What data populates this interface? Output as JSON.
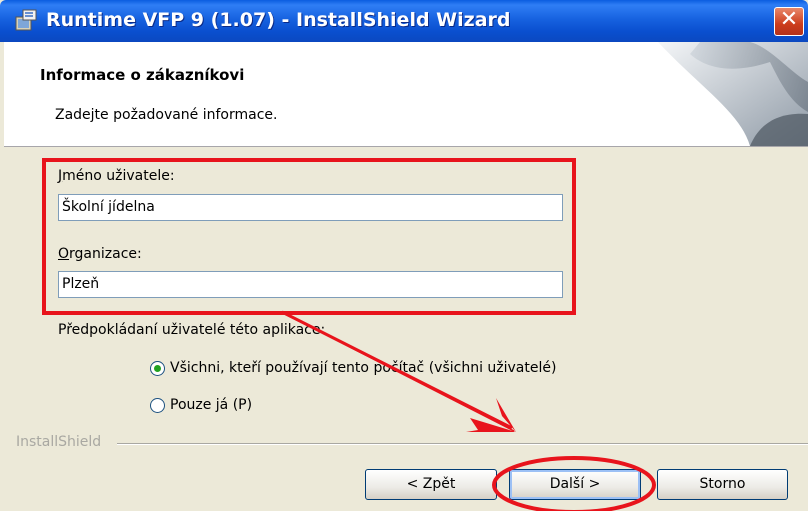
{
  "window": {
    "title": "Runtime VFP 9 (1.07) - InstallShield Wizard",
    "close_glyph": "✕"
  },
  "header": {
    "title": "Informace o zákazníkovi",
    "subtitle": "Zadejte požadované informace."
  },
  "form": {
    "username_label_accel": "J",
    "username_label_rest": "méno uživatele:",
    "username_value": "Školní jídelna",
    "org_label_accel": "O",
    "org_label_rest": "rganizace:",
    "org_value": "Plzeň",
    "users_question": "Předpokládaní uživatelé této aplikace:",
    "option_all": "Všichni, kteří používají tento počítač (všichni uživatelé)",
    "option_me": "Pouze já (P)",
    "selected_option": "option_all"
  },
  "footer": {
    "brand": "InstallShield",
    "back_label": "< Zpět",
    "next_label": "Další >",
    "cancel_label": "Storno"
  },
  "annotations": {
    "highlight_color": "#e8141c"
  },
  "icons": [
    "installer-app-icon",
    "close-icon",
    "header-page-curl-art"
  ]
}
